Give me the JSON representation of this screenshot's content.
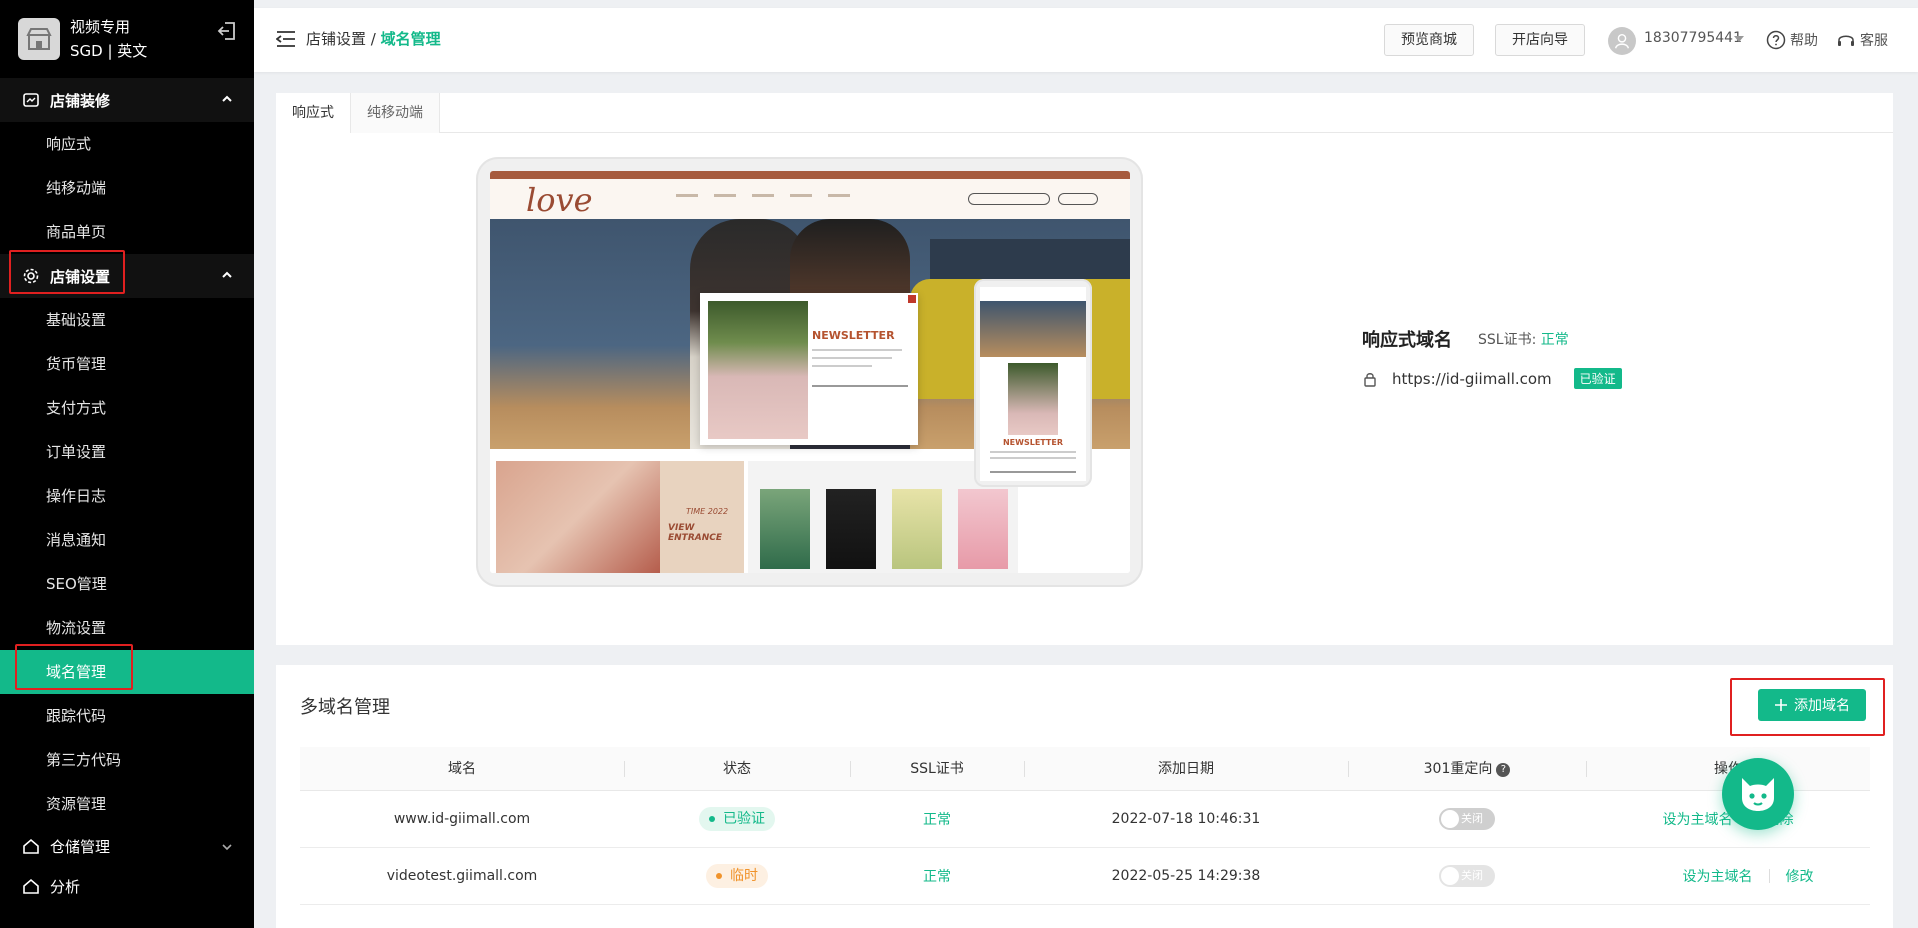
{
  "store": {
    "name": "视频专用",
    "locale": "SGD | 英文"
  },
  "sidebar": {
    "groups": [
      {
        "label": "店铺装修",
        "items": [
          "响应式",
          "纯移动端",
          "商品单页"
        ]
      },
      {
        "label": "店铺设置",
        "items": [
          "基础设置",
          "货币管理",
          "支付方式",
          "订单设置",
          "操作日志",
          "消息通知",
          "SEO管理",
          "物流设置",
          "域名管理",
          "跟踪代码",
          "第三方代码",
          "资源管理"
        ]
      },
      {
        "label": "仓储管理"
      },
      {
        "label": "分析"
      }
    ],
    "active_item": "域名管理"
  },
  "header": {
    "breadcrumb_parent": "店铺设置 / ",
    "breadcrumb_current": "域名管理",
    "preview_button": "预览商城",
    "wizard_button": "开店向导",
    "user_phone": "18307795441",
    "help_label": "帮助",
    "service_label": "客服"
  },
  "preview": {
    "tabs": [
      "响应式",
      "纯移动端"
    ],
    "active_tab": "响应式",
    "mock_site": {
      "logo": "love",
      "newsletter_title": "NEWSLETTER",
      "banner_line1": "TIME 2022",
      "banner_line2": "VIEW ENTRANCE"
    },
    "domain_title": "响应式域名",
    "ssl_label": "SSL证书:",
    "ssl_status": "正常",
    "domain_url": "https://id-giimall.com",
    "verified_badge": "已验证"
  },
  "multi_domain": {
    "title": "多域名管理",
    "add_button": "添加域名",
    "columns": [
      "域名",
      "状态",
      "SSL证书",
      "添加日期",
      "301重定向",
      "操作"
    ],
    "rows": [
      {
        "domain": "www.id-giimall.com",
        "status": "已验证",
        "ssl": "正常",
        "date": "2022-07-18 10:46:31",
        "redirect": "关闭",
        "action1": "设为主域名",
        "action2": "删除"
      },
      {
        "domain": "videotest.giimall.com",
        "status": "临时",
        "ssl": "正常",
        "date": "2022-05-25 14:29:38",
        "redirect": "关闭",
        "action1": "设为主域名",
        "action2": "修改"
      }
    ]
  },
  "colors": {
    "accent": "#13b98a",
    "sidebar_bg": "#000000",
    "highlight_box": "#e02020",
    "pending": "#f0932b"
  }
}
